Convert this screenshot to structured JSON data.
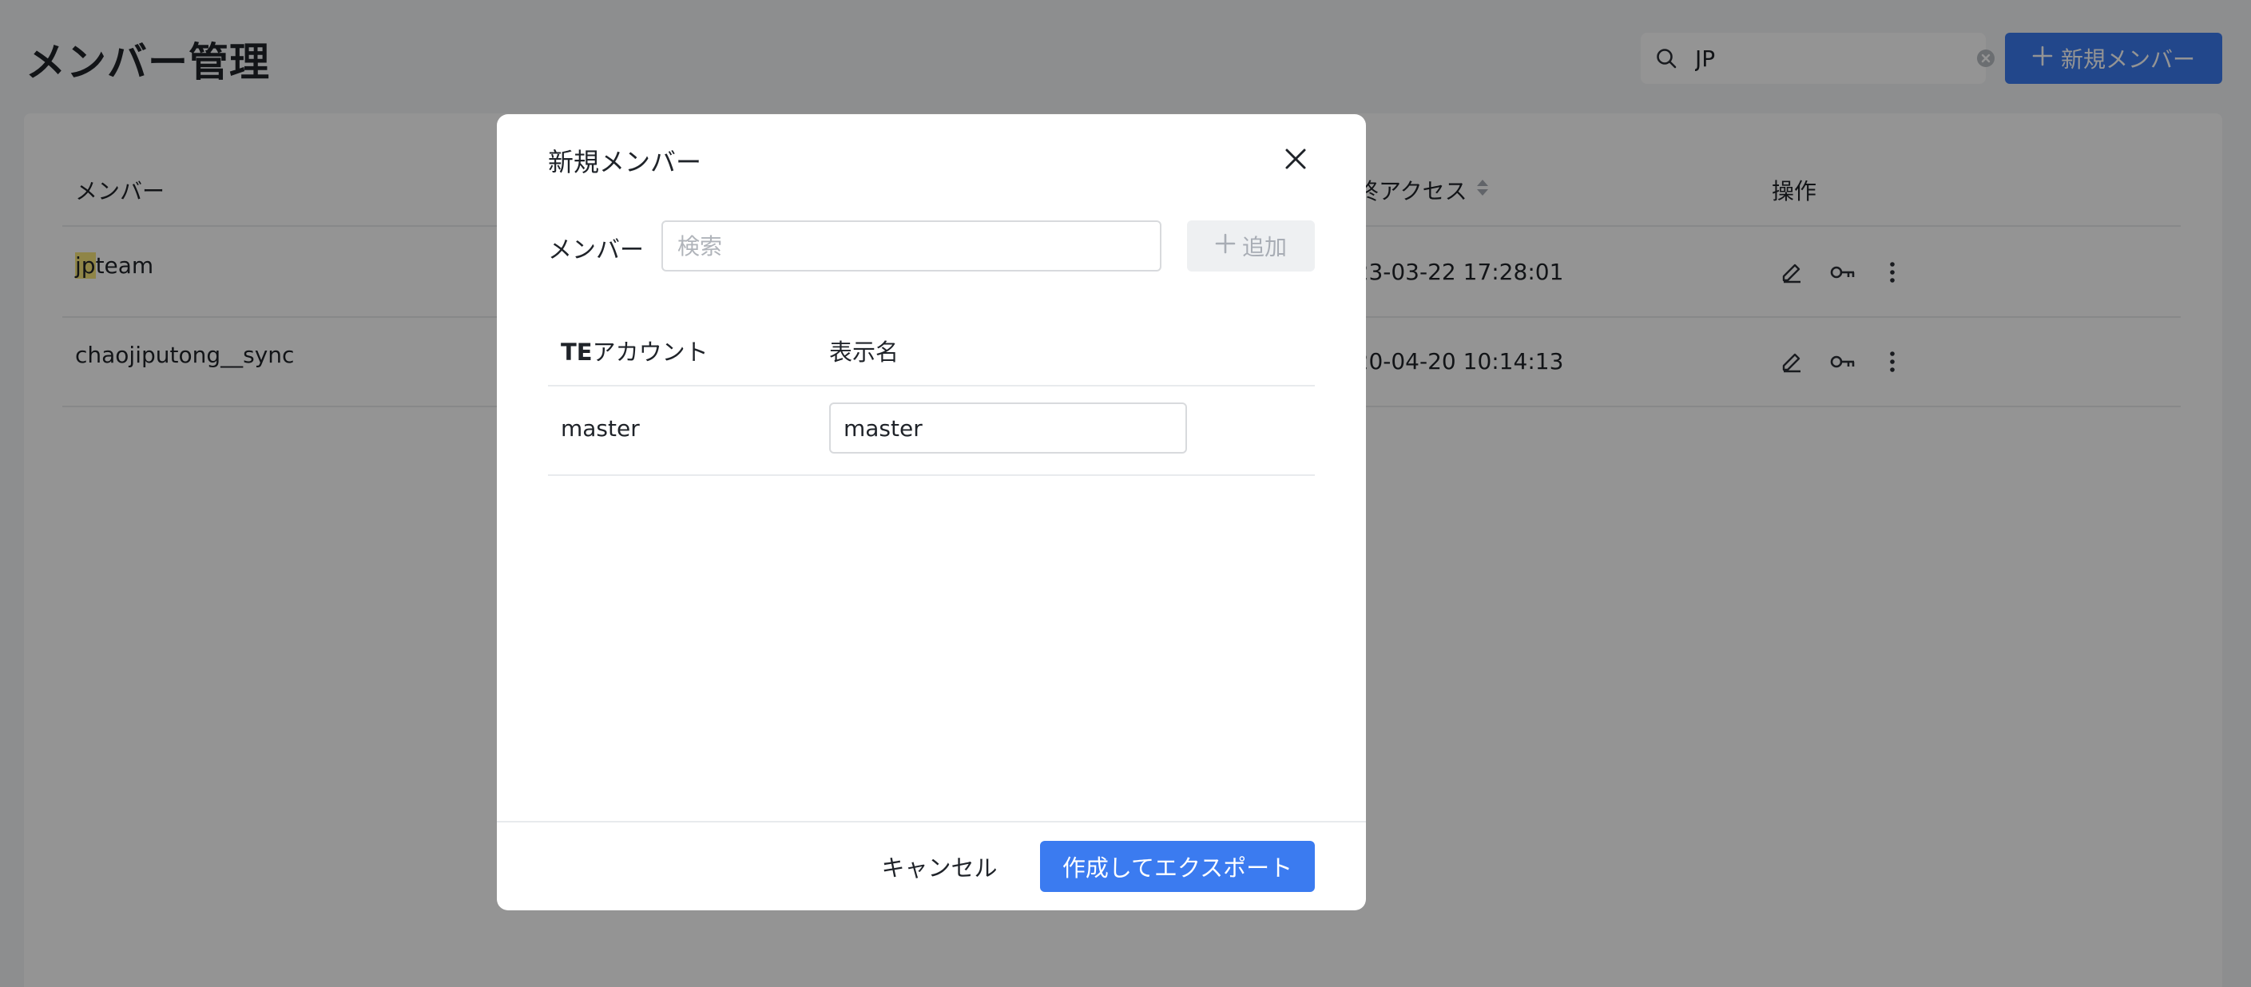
{
  "page": {
    "title": "メンバー管理",
    "search_value": "JP",
    "new_member_label": "新規メンバー"
  },
  "table": {
    "columns": {
      "member": "メンバー",
      "last_access": "最終アクセス",
      "actions": "操作"
    },
    "rows": [
      {
        "member_highlight": "jp",
        "member_rest": "team",
        "last_access": "2023-03-22 17:28:01"
      },
      {
        "member_highlight": "",
        "member_rest": "chaojiputong__sync",
        "last_access": "2020-04-20 10:14:13"
      }
    ]
  },
  "modal": {
    "title": "新規メンバー",
    "member_label": "メンバー",
    "search_placeholder": "検索",
    "add_label": "追加",
    "columns": {
      "account_prefix": "TE",
      "account_suffix": "アカウント",
      "display_name": "表示名"
    },
    "rows": [
      {
        "account": "master",
        "display_name": "master"
      }
    ],
    "cancel_label": "キャンセル",
    "submit_label": "作成してエクスポート"
  },
  "colors": {
    "primary": "#3b7bf0",
    "highlight": "#f7e67a",
    "overlay": "rgba(0,0,0,0.42)"
  },
  "icons": {
    "search": "search-icon",
    "clear": "clear-icon",
    "plus": "plus-icon",
    "sort": "sort-icon",
    "edit": "edit-icon",
    "key": "key-icon",
    "more": "more-vertical-icon",
    "close": "close-icon"
  }
}
